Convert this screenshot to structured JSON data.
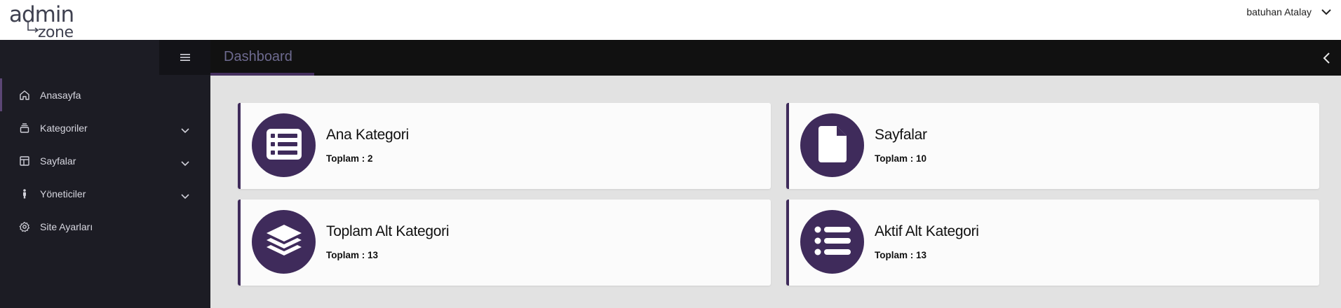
{
  "brand": {
    "logo_text_top": "admin",
    "logo_text_bottom": "zone"
  },
  "topbar": {
    "user_name": "batuhan Atalay",
    "user_menu_icon": "chevron-down-icon"
  },
  "sidebar": {
    "toggle_icon": "hamburger-icon",
    "items": [
      {
        "label": "Anasayfa",
        "icon": "home-icon",
        "active": true,
        "has_submenu": false
      },
      {
        "label": "Kategoriler",
        "icon": "layers-icon",
        "active": false,
        "has_submenu": true
      },
      {
        "label": "Sayfalar",
        "icon": "layout-icon",
        "active": false,
        "has_submenu": true
      },
      {
        "label": "Yöneticiler",
        "icon": "person-icon",
        "active": false,
        "has_submenu": true
      },
      {
        "label": "Site Ayarları",
        "icon": "gear-icon",
        "active": false,
        "has_submenu": false
      }
    ]
  },
  "header": {
    "title": "Dashboard",
    "collapse_icon": "chevron-left-icon"
  },
  "cards": [
    {
      "title": "Ana Kategori",
      "count_text": "Toplam : 2",
      "icon": "list-icon"
    },
    {
      "title": "Sayfalar",
      "count_text": "Toplam : 10",
      "icon": "file-icon"
    },
    {
      "title": "Toplam Alt Kategori",
      "count_text": "Toplam : 13",
      "icon": "layers-icon"
    },
    {
      "title": "Aktif Alt Kategori",
      "count_text": "Toplam : 13",
      "icon": "list-ul-icon"
    }
  ],
  "colors": {
    "accent": "#3f2b5b",
    "sidebar_bg": "#1c1c24",
    "header_bg": "#111111",
    "content_bg": "#e2e2e2",
    "header_title": "#6d6a8f"
  }
}
